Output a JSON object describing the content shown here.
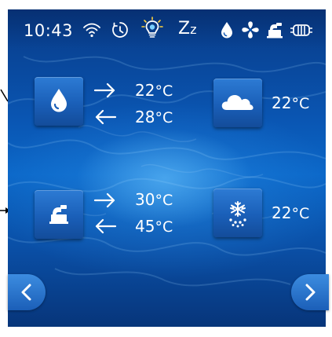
{
  "status_bar": {
    "time": "10:43",
    "sleep_label": "Z",
    "sleep_label_small": "z",
    "icons": [
      "wifi-icon",
      "timer-icon",
      "bulb-icon",
      "sleep-icon",
      "water-drop-icon",
      "fan-icon",
      "compressor-icon",
      "heater-icon"
    ]
  },
  "rows": [
    {
      "left_tile_icon": "water-drop-icon",
      "in_arrow_icon": "arrow-right-icon",
      "out_arrow_icon": "arrow-left-icon",
      "in_temp": "22",
      "out_temp": "28",
      "right_tile_icon": "cloud-icon",
      "right_temp": "22"
    },
    {
      "left_tile_icon": "compressor-icon",
      "in_arrow_icon": "arrow-right-icon",
      "out_arrow_icon": "arrow-left-icon",
      "in_temp": "30",
      "out_temp": "45",
      "right_tile_icon": "defrost-icon",
      "right_temp": "22"
    }
  ],
  "unit": "°C",
  "nav": {
    "prev_icon": "chevron-left-icon",
    "next_icon": "chevron-right-icon"
  },
  "colors": {
    "accent": "#1a5fb8",
    "text": "#ffffff",
    "background": "#0b67c8"
  }
}
